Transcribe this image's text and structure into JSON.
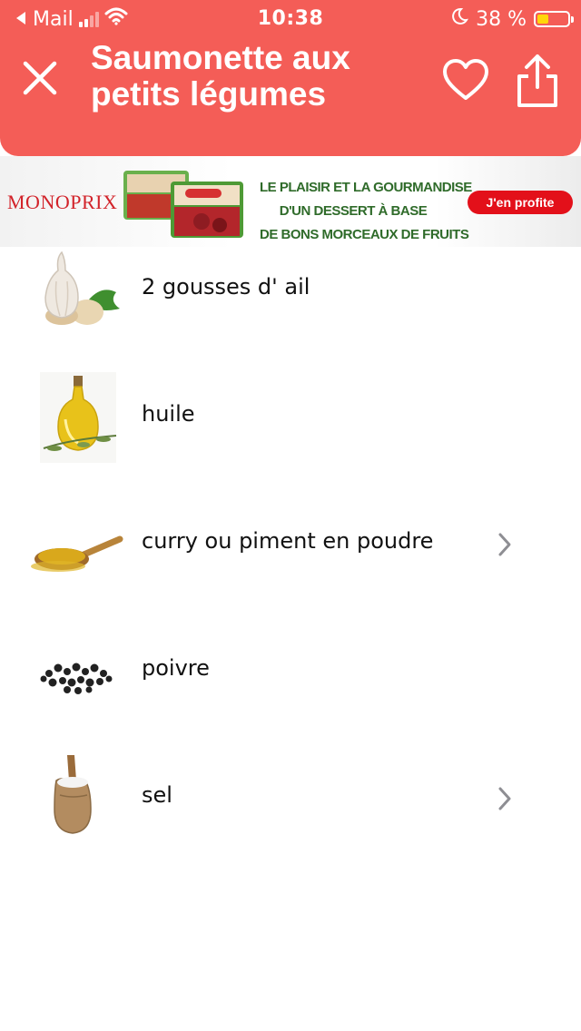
{
  "status_bar": {
    "back_app": "Mail",
    "time": "10:38",
    "battery": "38 %",
    "battery_level": 0.38
  },
  "header": {
    "title": "Saumonette aux petits légumes"
  },
  "ad": {
    "brand": "MONOPRIX",
    "copy_lines": [
      "LE PLAISIR ET LA GOURMANDISE",
      "D'UN DESSERT À BASE",
      "DE BONS MORCEAUX DE FRUITS"
    ],
    "cta": "J'en profite"
  },
  "ingredients": [
    {
      "label": "2 gousses d' ail",
      "icon": "garlic-icon",
      "has_link": false
    },
    {
      "label": "huile",
      "icon": "oil-bottle-icon",
      "has_link": false
    },
    {
      "label": "curry ou piment en poudre",
      "icon": "spice-spoon-icon",
      "has_link": true
    },
    {
      "label": "poivre",
      "icon": "peppercorns-icon",
      "has_link": false
    },
    {
      "label": "sel",
      "icon": "salt-sack-icon",
      "has_link": true
    }
  ],
  "colors": {
    "header": "#f45d57",
    "ad_brand": "#d2232a",
    "ad_cta": "#e3101a",
    "ad_copy": "#2f6b2a"
  }
}
